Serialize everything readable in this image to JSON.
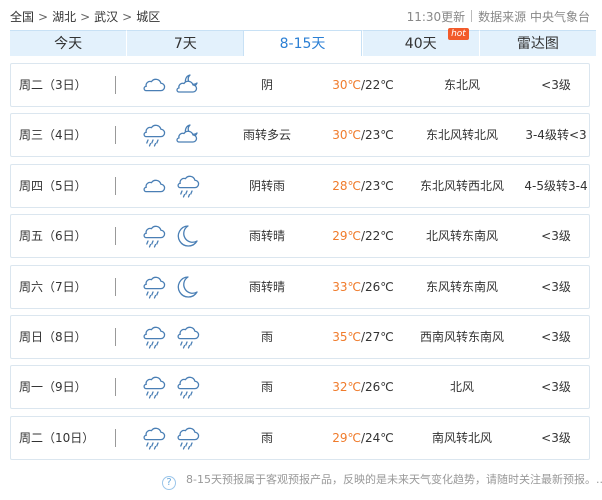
{
  "breadcrumb": {
    "items": [
      "全国",
      "湖北",
      "武汉",
      "城区"
    ],
    "separator": ">"
  },
  "meta": {
    "updated": "11:30更新",
    "source": "数据来源 中央气象台"
  },
  "tabs": [
    {
      "label": "今天",
      "active": false
    },
    {
      "label": "7天",
      "active": false
    },
    {
      "label": "8-15天",
      "active": true
    },
    {
      "label": "40天",
      "active": false,
      "badge": "hot"
    },
    {
      "label": "雷达图",
      "active": false
    }
  ],
  "colors": {
    "accent": "#2b7fd4",
    "high_temp": "#f07b2b",
    "tab_bg": "#e3f1fc",
    "hot_badge": "#f25a2a",
    "icon": "#4a7fb5"
  },
  "forecast": [
    {
      "day": "周二（3日）",
      "icon_day": "cloudy-icon",
      "icon_night": "partly-cloudy-night-icon",
      "desc": "阴",
      "high": "30℃",
      "low": "/22℃",
      "wind": "东北风",
      "level": "<3级"
    },
    {
      "day": "周三（4日）",
      "icon_day": "rain-icon",
      "icon_night": "partly-cloudy-night-icon",
      "desc": "雨转多云",
      "high": "30℃",
      "low": "/23℃",
      "wind": "东北风转北风",
      "level": "3-4级转<3"
    },
    {
      "day": "周四（5日）",
      "icon_day": "cloudy-icon",
      "icon_night": "rain-icon",
      "desc": "阴转雨",
      "high": "28℃",
      "low": "/23℃",
      "wind": "东北风转西北风",
      "level": "4-5级转3-4"
    },
    {
      "day": "周五（6日）",
      "icon_day": "rain-icon",
      "icon_night": "clear-night-icon",
      "desc": "雨转晴",
      "high": "29℃",
      "low": "/22℃",
      "wind": "北风转东南风",
      "level": "<3级"
    },
    {
      "day": "周六（7日）",
      "icon_day": "rain-icon",
      "icon_night": "clear-night-icon",
      "desc": "雨转晴",
      "high": "33℃",
      "low": "/26℃",
      "wind": "东风转东南风",
      "level": "<3级"
    },
    {
      "day": "周日（8日）",
      "icon_day": "rain-icon",
      "icon_night": "rain-icon",
      "desc": "雨",
      "high": "35℃",
      "low": "/27℃",
      "wind": "西南风转东南风",
      "level": "<3级"
    },
    {
      "day": "周一（9日）",
      "icon_day": "rain-icon",
      "icon_night": "rain-icon",
      "desc": "雨",
      "high": "32℃",
      "low": "/26℃",
      "wind": "北风",
      "level": "<3级"
    },
    {
      "day": "周二（10日）",
      "icon_day": "rain-icon",
      "icon_night": "rain-icon",
      "desc": "雨",
      "high": "29℃",
      "low": "/24℃",
      "wind": "南风转北风",
      "level": "<3级"
    }
  ],
  "notice": {
    "icon": "question-icon",
    "icon_glyph": "?",
    "text": "8-15天预报属于客观预报产品，反映的是未来天气变化趋势，请随时关注最新预报。..."
  }
}
